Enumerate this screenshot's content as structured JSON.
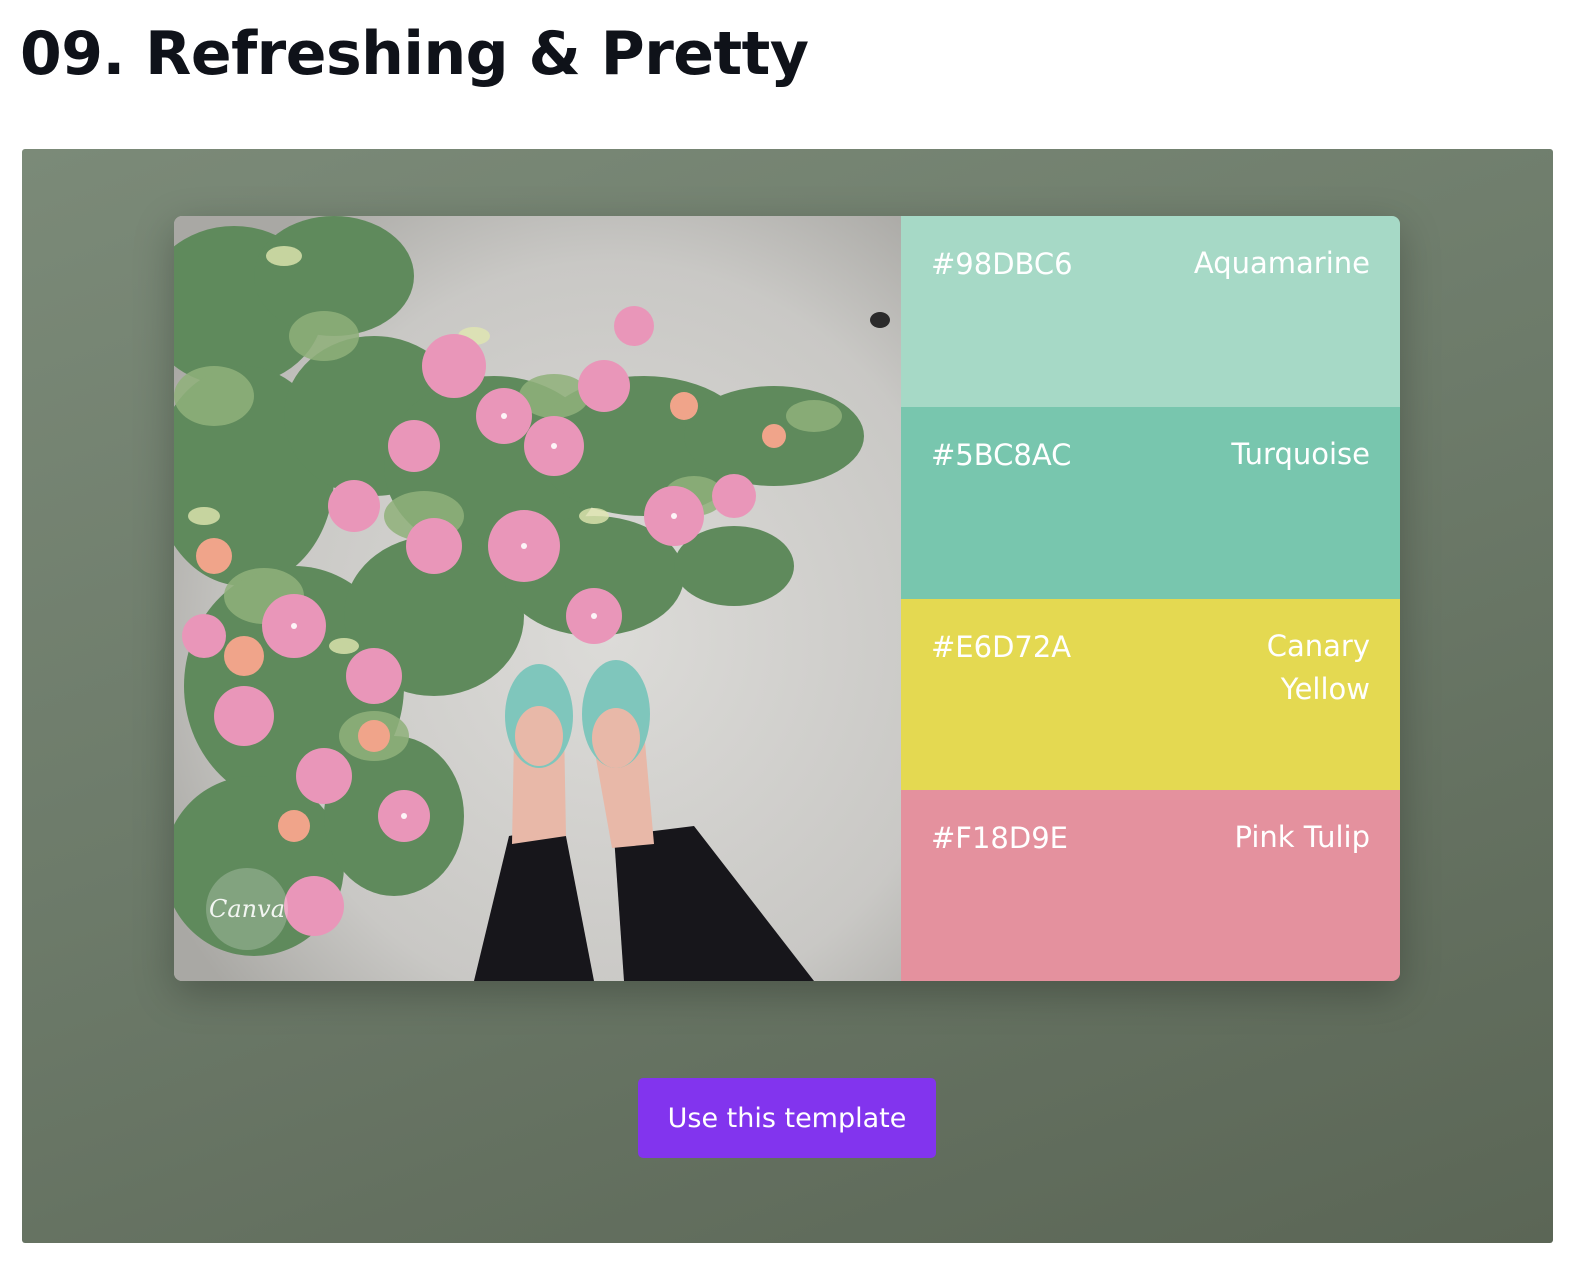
{
  "page": {
    "title": "09. Refreshing & Pretty"
  },
  "photo": {
    "watermark": "Canva",
    "description_icon": "photo-flowers-shoes"
  },
  "palette": [
    {
      "hex": "#98DBC6",
      "name": "Aquamarine",
      "color": "#a6d9c6"
    },
    {
      "hex": "#5BC8AC",
      "name": "Turquoise",
      "color": "#78c6ae"
    },
    {
      "hex": "#E6D72A",
      "name": "Canary Yellow",
      "color": "#e4d951"
    },
    {
      "hex": "#F18D9E",
      "name": "Pink Tulip",
      "color": "#e4919e"
    }
  ],
  "cta": {
    "label": "Use this template",
    "color": "#8234ee"
  },
  "colors": {
    "stage_background": "#6d7b6a",
    "title_text": "#0f1219"
  }
}
